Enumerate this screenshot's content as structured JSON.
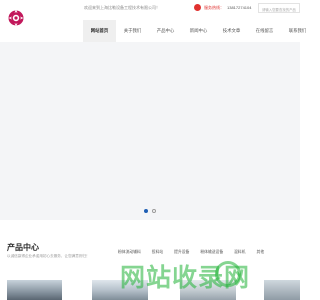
{
  "header": {
    "welcome": "欢迎来到上海比勒设备工程技术有限公司！",
    "hotline_label": "服务热线：",
    "hotline_number": "13817274104",
    "search_placeholder": "请输入您要查找的产品"
  },
  "nav": {
    "items": [
      {
        "label": "网站首页",
        "active": true
      },
      {
        "label": "关于我们"
      },
      {
        "label": "产品中心"
      },
      {
        "label": "新闻中心"
      },
      {
        "label": "技术文章"
      },
      {
        "label": "在线留言"
      },
      {
        "label": "联系我们"
      }
    ]
  },
  "banner": {
    "slide_count": 2,
    "active_slide": 1
  },
  "products": {
    "title": "产品中心",
    "subtitle": "以诚信赢得企业承诺用初心去服务，让您满意则归！",
    "categories": [
      "粉体流动辅料",
      "投料站",
      "提升设备",
      "粉体输送设备",
      "混料机",
      "其他"
    ]
  },
  "watermark": {
    "text": "网站收录网"
  },
  "colors": {
    "accent": "#1e5fb4",
    "hotline": "#e0312f",
    "logo": "#c2185b"
  }
}
